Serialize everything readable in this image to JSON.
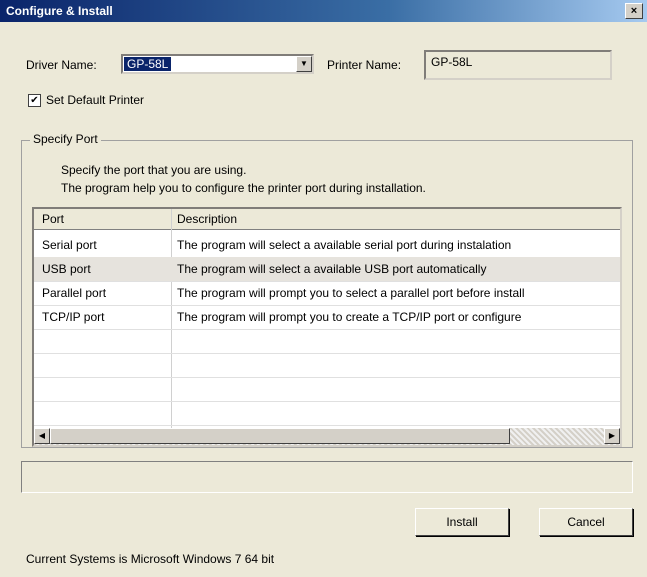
{
  "window": {
    "title": "Configure & Install",
    "close_label": "×"
  },
  "driver": {
    "label": "Driver Name:",
    "value": "GP-58L",
    "dropdown_icon": "▼"
  },
  "printer": {
    "label": "Printer Name:",
    "value": "GP-58L"
  },
  "default_printer": {
    "label": "Set Default Printer",
    "checked": "✔"
  },
  "port_group": {
    "title": "Specify Port",
    "line1": "Specify the port that you are using.",
    "line2": "The program help you to configure the printer port during installation."
  },
  "table": {
    "headers": [
      "Port",
      "Description"
    ],
    "rows": [
      {
        "port": "Serial port",
        "desc": "The program will select a available serial port during instalation"
      },
      {
        "port": "USB port",
        "desc": "The program will select a available USB port automatically"
      },
      {
        "port": "Parallel port",
        "desc": "The program will prompt you to select a parallel port before install"
      },
      {
        "port": "TCP/IP port",
        "desc": "The program will prompt you to create a TCP/IP port or configure"
      }
    ]
  },
  "buttons": {
    "install": "Install",
    "cancel": "Cancel"
  },
  "status": "Current Systems is Microsoft Windows 7  64 bit"
}
